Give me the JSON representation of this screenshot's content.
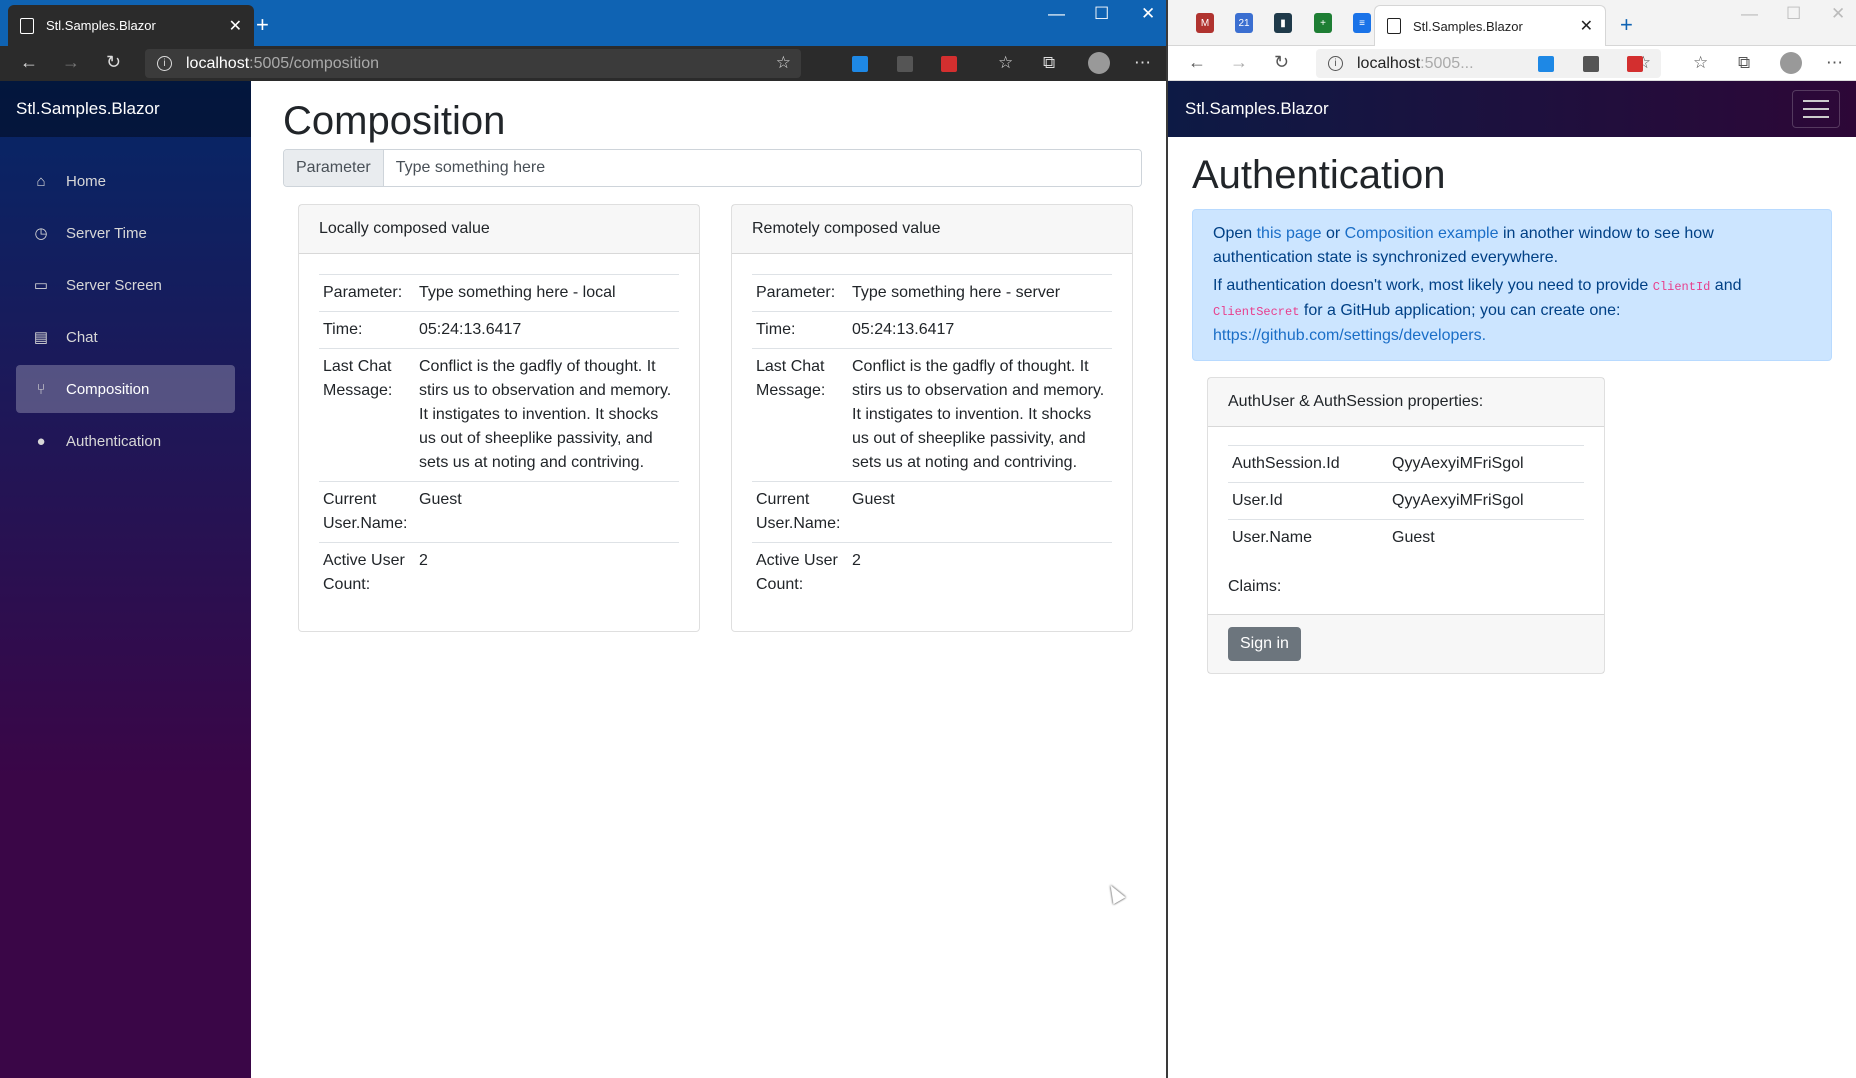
{
  "left": {
    "tab_title": "Stl.Samples.Blazor",
    "url_host": "localhost",
    "url_path": ":5005/composition",
    "brand": "Stl.Samples.Blazor",
    "nav": [
      {
        "label": "Home",
        "icon": "home-icon"
      },
      {
        "label": "Server Time",
        "icon": "clock-icon"
      },
      {
        "label": "Server Screen",
        "icon": "monitor-icon"
      },
      {
        "label": "Chat",
        "icon": "chat-icon"
      },
      {
        "label": "Composition",
        "icon": "fork-icon"
      },
      {
        "label": "Authentication",
        "icon": "person-icon"
      }
    ],
    "page_title": "Composition",
    "parameter_label": "Parameter",
    "parameter_value": "Type something here",
    "local_card": {
      "header": "Locally composed value",
      "rows": [
        {
          "key": "Parameter:",
          "value": "Type something here - local"
        },
        {
          "key": "Time:",
          "value": "05:24:13.6417"
        },
        {
          "key": "Last Chat Message:",
          "value": "Conflict is the gadfly of thought. It stirs us to observation and memory. It instigates to invention. It shocks us out of sheeplike passivity, and sets us at noting and contriving."
        },
        {
          "key": "Current User.Name:",
          "value": "Guest"
        },
        {
          "key": "Active User Count:",
          "value": "2"
        }
      ]
    },
    "remote_card": {
      "header": "Remotely composed value",
      "rows": [
        {
          "key": "Parameter:",
          "value": "Type something here - server"
        },
        {
          "key": "Time:",
          "value": "05:24:13.6417"
        },
        {
          "key": "Last Chat Message:",
          "value": "Conflict is the gadfly of thought. It stirs us to observation and memory. It instigates to invention. It shocks us out of sheeplike passivity, and sets us at noting and contriving."
        },
        {
          "key": "Current User.Name:",
          "value": "Guest"
        },
        {
          "key": "Active User Count:",
          "value": "2"
        }
      ]
    }
  },
  "right": {
    "tab_title": "Stl.Samples.Blazor",
    "url_host": "localhost",
    "url_path": ":5005...",
    "brand": "Stl.Samples.Blazor",
    "page_title": "Authentication",
    "alert": {
      "open": "Open ",
      "link1": "this page",
      "or": " or ",
      "link2": "Composition example",
      "rest1": " in another window to see how authentication state is synchronized everywhere.",
      "p2a": "If authentication doesn't work, most likely you need to provide ",
      "code1": "ClientId",
      "and": " and ",
      "code2": "ClientSecret",
      "p2b": " for a GitHub application; you can create one: ",
      "link3": "https://github.com/settings/developers."
    },
    "card_header": "AuthUser & AuthSession properties:",
    "rows": [
      {
        "key": "AuthSession.Id",
        "value": "QyyAexyiMFriSgol"
      },
      {
        "key": "User.Id",
        "value": "QyyAexyiMFriSgol"
      },
      {
        "key": "User.Name",
        "value": "Guest"
      }
    ],
    "claims_label": "Claims:",
    "sign_in": "Sign in"
  }
}
